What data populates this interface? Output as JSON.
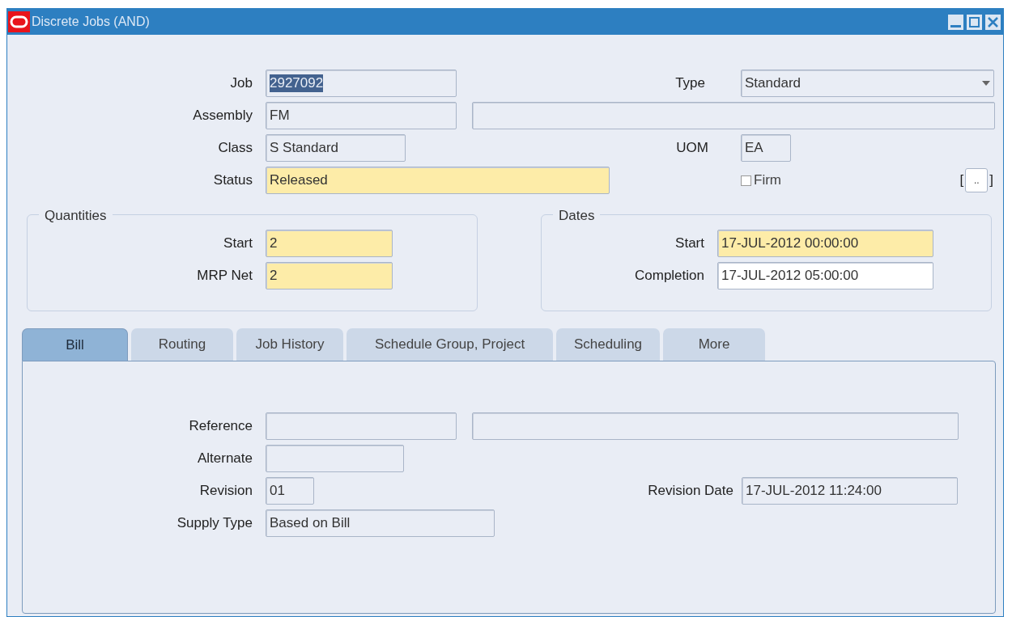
{
  "window": {
    "title": "Discrete Jobs (AND)"
  },
  "header": {
    "job": {
      "label": "Job",
      "value": "2927092",
      "kind": "readonly",
      "highlighted": true
    },
    "type": {
      "label": "Type",
      "value": "Standard",
      "kind": "readonly"
    },
    "assembly": {
      "label": "Assembly",
      "value": "FM",
      "kind": "readonly"
    },
    "assembly_description": {
      "kind": "readonly"
    },
    "class": {
      "label": "Class",
      "value": "S Standard",
      "kind": "readonly"
    },
    "uom": {
      "label": "UOM",
      "value": "EA",
      "kind": "readonly"
    },
    "status": {
      "label": "Status",
      "value": "Released",
      "kind": "required"
    },
    "firm": {
      "label": "Firm",
      "checked": false
    },
    "flexfield": {
      "open": "[",
      "value": "..",
      "close": "]"
    }
  },
  "quantities": {
    "title": "Quantities",
    "fields": [
      {
        "label": "Start",
        "value": "2",
        "kind": "required"
      },
      {
        "label": "MRP Net",
        "value": "2",
        "kind": "required"
      }
    ]
  },
  "dates": {
    "title": "Dates",
    "fields": [
      {
        "label": "Start",
        "value": "17-JUL-2012 00:00:00",
        "kind": "required"
      },
      {
        "label": "Completion",
        "value": "17-JUL-2012 05:00:00",
        "kind": "editable"
      }
    ]
  },
  "tabs": [
    {
      "label": "Bill",
      "selected": true
    },
    {
      "label": "Routing",
      "selected": false
    },
    {
      "label": "Job History",
      "selected": false
    },
    {
      "label": "Schedule Group, Project",
      "selected": false
    },
    {
      "label": "Scheduling",
      "selected": false
    },
    {
      "label": "More",
      "selected": false
    }
  ],
  "bill": {
    "reference": {
      "label": "Reference",
      "kind": "readonly"
    },
    "reference_description": {
      "kind": "readonly"
    },
    "alternate": {
      "label": "Alternate",
      "kind": "readonly"
    },
    "revision": {
      "label": "Revision",
      "value": "01",
      "kind": "readonly"
    },
    "revision_date": {
      "label": "Revision Date",
      "value": "17-JUL-2012 11:24:00",
      "kind": "readonly"
    },
    "supply_type": {
      "label": "Supply Type",
      "value": "Based on Bill",
      "kind": "readonly"
    }
  }
}
